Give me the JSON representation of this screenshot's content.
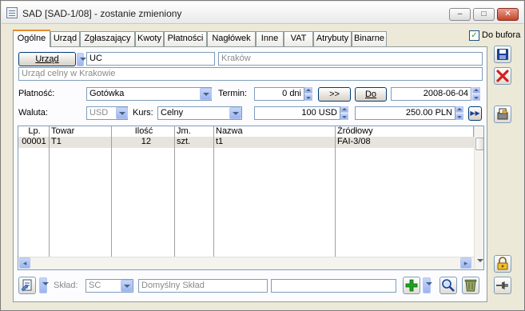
{
  "window": {
    "title": "SAD [SAD-1/08]  - zostanie zmieniony",
    "minimize": "–",
    "maximize": "□",
    "close": "✕"
  },
  "do_bufora": {
    "label": "Do bufora",
    "checked": true
  },
  "tabs": [
    {
      "label": "Ogólne",
      "active": true
    },
    {
      "label": "Urząd"
    },
    {
      "label": "Zgłaszający"
    },
    {
      "label": "Kwoty"
    },
    {
      "label": "Płatności"
    },
    {
      "label": "Nagłówek"
    },
    {
      "label": "Inne"
    },
    {
      "label": "VAT"
    },
    {
      "label": "Atrybuty"
    },
    {
      "label": "Binarne"
    }
  ],
  "urzad": {
    "button_label": "Urząd",
    "code": "UC",
    "city": "Kraków",
    "full_name": "Urząd celny w Krakowie"
  },
  "platnosc": {
    "label": "Płatność:",
    "value": "Gotówka"
  },
  "termin": {
    "label": "Termin:",
    "days": "0 dni",
    "shift_button": ">>",
    "do_button": "Do",
    "date": "2008-06-04"
  },
  "waluta": {
    "label": "Waluta:",
    "value": "USD",
    "kurs_label": "Kurs:",
    "kurs_value": "Celny",
    "amount_foreign": "100 USD",
    "amount_pln": "250.00 PLN",
    "next_button": "▶▶"
  },
  "table": {
    "columns": [
      "Lp.",
      "Towar",
      "Ilość",
      "Jm.",
      "Nazwa",
      "Źródłowy"
    ],
    "rows": [
      {
        "lp": "00001",
        "towar": "T1",
        "ilosc": "12",
        "jm": "szt.",
        "nazwa": "t1",
        "zrodlowy": "FAI-3/08"
      }
    ]
  },
  "bottom": {
    "sklad_label": "Skład:",
    "sklad_code": "SC",
    "sklad_name": "Domyślny Skład",
    "extra_field": ""
  },
  "colors": {
    "accent_tab": "#e68b2c",
    "window_bg": "#ece9d8",
    "panel_bg": "#fcfcfe",
    "input_border": "#7f9db9",
    "save_icon": "#1c3f94",
    "cancel_icon": "#d42020",
    "add_icon": "#21a121"
  }
}
